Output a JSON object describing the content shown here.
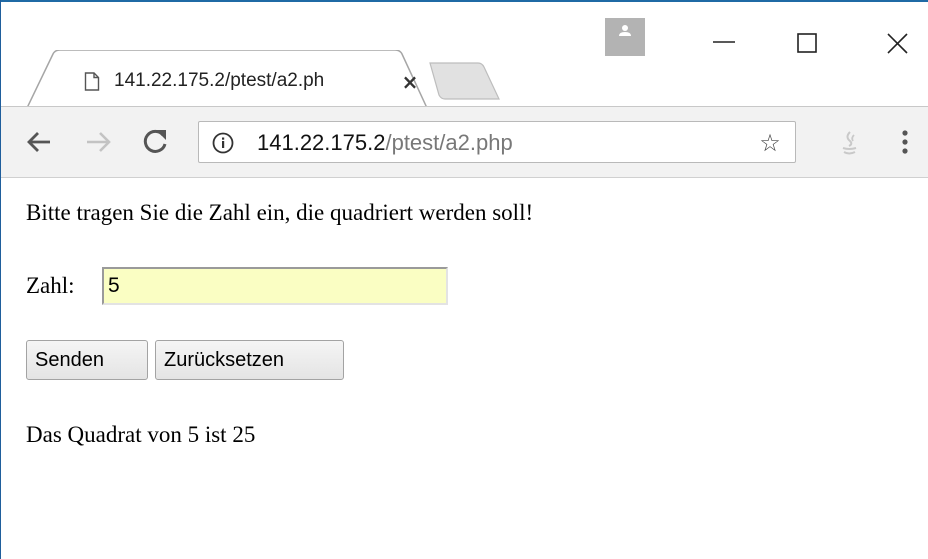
{
  "browser": {
    "tab": {
      "title": "141.22.175.2/ptest/a2.ph",
      "close_glyph": "×",
      "page_icon": "page-icon"
    },
    "address_bar": {
      "url_host": "141.22.175.2",
      "url_path": "/ptest/a2.php",
      "info_icon": "info-icon",
      "star_glyph": "☆"
    },
    "toolbar_icons": [
      "back-arrow-icon",
      "forward-arrow-icon",
      "reload-icon",
      "java-extension-icon",
      "menu-kebab-icon"
    ],
    "window_controls": [
      "profile-icon",
      "minimize-icon",
      "maximize-icon",
      "close-icon"
    ]
  },
  "page": {
    "intro": "Bitte tragen Sie die Zahl ein, die quadriert werden soll!",
    "zahl_label": "Zahl:",
    "zahl_value": "5",
    "send_button": "Senden",
    "reset_button": "Zurücksetzen",
    "result": "Das Quadrat von 5 ist 25"
  },
  "colors": {
    "input_autofill_bg": "#fafec3",
    "toolbar_bg": "#f2f2f2",
    "window_border": "#1f6aa5"
  }
}
